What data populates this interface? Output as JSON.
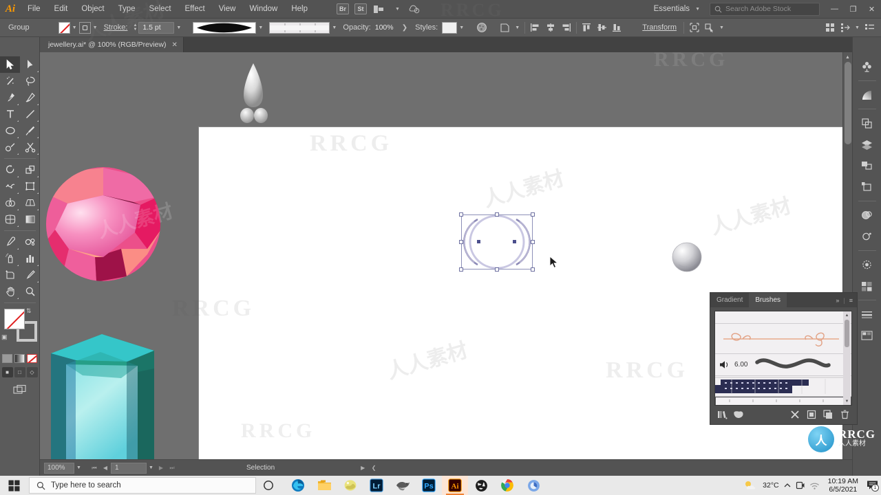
{
  "app": {
    "name": "Adobe Illustrator",
    "logo_text": "Ai"
  },
  "menubar": {
    "items": [
      "File",
      "Edit",
      "Object",
      "Type",
      "Select",
      "Effect",
      "View",
      "Window",
      "Help"
    ],
    "bridge_label": "Br",
    "stock_label": "St",
    "workspace": "Essentials",
    "search_placeholder": "Search Adobe Stock",
    "minimize": "—",
    "maximize": "❐",
    "close": "✕"
  },
  "controlbar": {
    "selection_label": "Group",
    "stroke_label": "Stroke:",
    "stroke_weight": "1.5 pt",
    "opacity_label": "Opacity:",
    "opacity_value": "100%",
    "styles_label": "Styles:",
    "transform_label": "Transform"
  },
  "document": {
    "tab_title": "jewellery.ai* @ 100% (RGB/Preview)",
    "close_glyph": "✕"
  },
  "toolbar": {
    "tools": [
      "selection-tool",
      "direct-selection-tool",
      "magic-wand-tool",
      "lasso-tool",
      "pen-tool",
      "curvature-tool",
      "type-tool",
      "line-segment-tool",
      "ellipse-tool",
      "paintbrush-tool",
      "shaper-tool",
      "scissors-tool",
      "rotate-tool",
      "scale-tool",
      "width-tool",
      "free-transform-tool",
      "shape-builder-tool",
      "perspective-grid-tool",
      "mesh-tool",
      "gradient-tool",
      "eyedropper-tool",
      "blend-tool",
      "symbol-sprayer-tool",
      "column-graph-tool",
      "artboard-tool",
      "slice-tool",
      "hand-tool",
      "zoom-tool"
    ],
    "active_tool": "selection-tool"
  },
  "statusbar": {
    "zoom_level": "100%",
    "artboard_number": "1",
    "tool_indicator": "Selection"
  },
  "panel": {
    "tabs": [
      {
        "label": "Gradient",
        "active": false
      },
      {
        "label": "Brushes",
        "active": true
      }
    ],
    "collapse_glyph": "»",
    "menu_glyph": "≡",
    "brushes": [
      {
        "name": "",
        "type": "art-brush-ornament"
      },
      {
        "name": "6.00",
        "type": "calligraphic-brush"
      },
      {
        "name": "",
        "type": "pattern-brush-dark"
      },
      {
        "name": "",
        "type": "scatter-brush-light"
      }
    ],
    "footer_icons": [
      "brush-libraries-icon",
      "libraries-panel-icon",
      "remove-brush-stroke-icon",
      "brush-options-icon",
      "new-brush-icon",
      "delete-brush-icon"
    ]
  },
  "rightdock": {
    "icons": [
      "symbols-panel-icon",
      "gradient-panel-icon",
      "pathfinder-panel-icon",
      "layers-panel-icon",
      "artboards-panel-icon",
      "transform-panel-icon",
      "appearance-panel-icon",
      "graphic-styles-panel-icon",
      "brushes-panel-icon",
      "swatches-panel-icon",
      "stroke-panel-icon",
      "color-guide-panel-icon"
    ]
  },
  "canvas": {
    "artwork": [
      "pink-faceted-gem",
      "teal-emerald-gem",
      "pearl-drop",
      "silver-sphere"
    ],
    "selected_object": "ring-shape"
  },
  "taskbar": {
    "search_placeholder": "Type here to search",
    "apps": [
      {
        "name": "microsoft-edge",
        "label": ""
      },
      {
        "name": "file-explorer",
        "label": ""
      },
      {
        "name": "picture-app",
        "label": ""
      },
      {
        "name": "adobe-lightroom",
        "label": "Lr"
      },
      {
        "name": "eagle-app",
        "label": ""
      },
      {
        "name": "adobe-photoshop",
        "label": "Ps"
      },
      {
        "name": "adobe-illustrator",
        "label": "Ai"
      },
      {
        "name": "dark-globe-app",
        "label": ""
      },
      {
        "name": "google-chrome",
        "label": ""
      },
      {
        "name": "browser-app",
        "label": ""
      }
    ],
    "weather": "32°C",
    "time": "10:19 AM",
    "date": "6/5/2021",
    "notification_count": "1"
  },
  "watermark": {
    "brand": "RRCG",
    "cn_text": "人人素材",
    "logo_glyph": "人"
  }
}
